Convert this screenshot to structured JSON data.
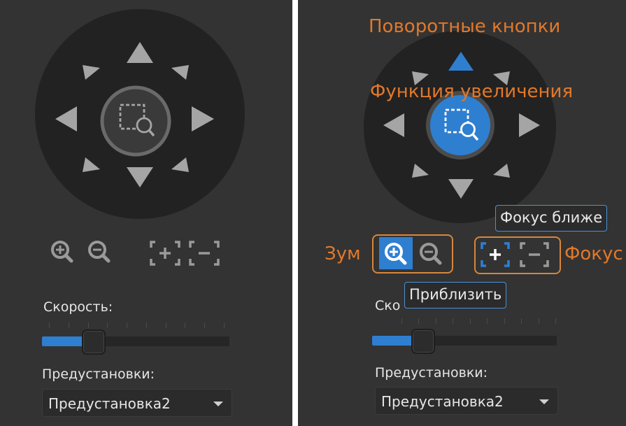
{
  "panels": [
    {
      "zoom_function_active": false,
      "speed_label": "Скорость:",
      "speed_level_fraction": 0.27,
      "presets_label": "Предустановки:",
      "presets_selected": "Предустановка2"
    },
    {
      "zoom_function_active": true,
      "speed_label": "Ско",
      "speed_level_fraction": 0.27,
      "presets_label": "Предустановки:",
      "presets_selected": "Предустановка2"
    }
  ],
  "annotations": {
    "rotate_buttons": "Поворотные кнопки",
    "zoom_function": "Функция увеличения",
    "zoom": "Зум",
    "focus": "Фокус",
    "tooltip_focus_near": "Фокус ближе",
    "tooltip_zoom_in": "Приблизить"
  },
  "colors": {
    "panel_bg": "#333333",
    "ptz_circle": "#222222",
    "arrow": "#a5a5a5",
    "accent_blue": "#2f7fd0",
    "annotation_orange": "#e2782a",
    "tooltip_border": "#4a90d9"
  },
  "icons": [
    "zoom-select-icon",
    "zoom-in-icon",
    "zoom-out-icon",
    "focus-near-icon",
    "focus-far-icon",
    "dropdown-caret-icon"
  ]
}
